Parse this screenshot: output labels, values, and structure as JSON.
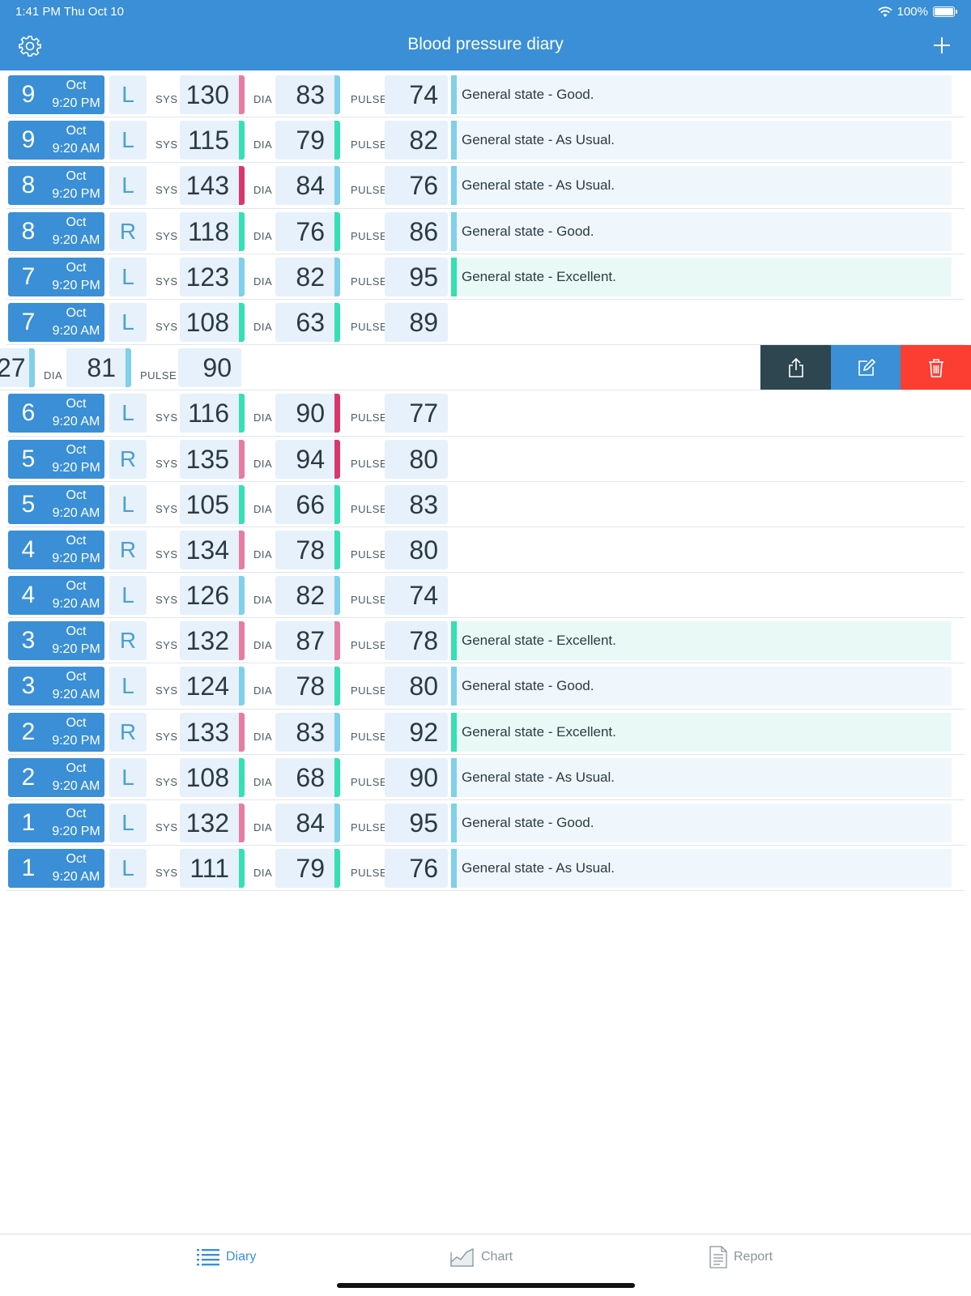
{
  "status_bar": {
    "time": "1:41 PM   Thu Oct 10",
    "battery": "100%"
  },
  "header": {
    "title": "Blood pressure diary"
  },
  "labels": {
    "sys": "SYS",
    "dia": "DIA",
    "pulse": "PULSE"
  },
  "colors": {
    "accent": "#3a8fd6",
    "bar_normal": "#7fd0ea",
    "bar_optimal": "#34e0b4",
    "bar_high_normal": "#e77ca3",
    "bar_high": "#d9366d",
    "note_excellent_bar": "#34e0b4",
    "note_default_bar": "#7fd0ea",
    "action_share": "#2d4650",
    "action_edit": "#3a8fd6",
    "action_delete": "#fb3d32"
  },
  "entries": [
    {
      "day": "9",
      "month": "Oct",
      "time": "9:20 PM",
      "arm": "L",
      "sys": "130",
      "dia": "83",
      "pulse": "74",
      "sys_color": "#e77ca3",
      "dia_color": "#7fd0ea",
      "note": "General state - Good.",
      "note_type": "good"
    },
    {
      "day": "9",
      "month": "Oct",
      "time": "9:20 AM",
      "arm": "L",
      "sys": "115",
      "dia": "79",
      "pulse": "82",
      "sys_color": "#34e0b4",
      "dia_color": "#34e0b4",
      "note": "General state - As Usual.",
      "note_type": "usual"
    },
    {
      "day": "8",
      "month": "Oct",
      "time": "9:20 PM",
      "arm": "L",
      "sys": "143",
      "dia": "84",
      "pulse": "76",
      "sys_color": "#d9366d",
      "dia_color": "#7fd0ea",
      "note": "General state - As Usual.",
      "note_type": "usual"
    },
    {
      "day": "8",
      "month": "Oct",
      "time": "9:20 AM",
      "arm": "R",
      "sys": "118",
      "dia": "76",
      "pulse": "86",
      "sys_color": "#34e0b4",
      "dia_color": "#34e0b4",
      "note": "General state - Good.",
      "note_type": "good"
    },
    {
      "day": "7",
      "month": "Oct",
      "time": "9:20 PM",
      "arm": "L",
      "sys": "123",
      "dia": "82",
      "pulse": "95",
      "sys_color": "#7fd0ea",
      "dia_color": "#7fd0ea",
      "note": "General state - Excellent.",
      "note_type": "excellent"
    },
    {
      "day": "7",
      "month": "Oct",
      "time": "9:20 AM",
      "arm": "L",
      "sys": "108",
      "dia": "63",
      "pulse": "89",
      "sys_color": "#34e0b4",
      "dia_color": "#34e0b4",
      "note": "",
      "note_type": ""
    },
    {
      "swiped": true,
      "sys_tail": "27",
      "dia": "81",
      "pulse": "90",
      "sys_color": "#7fd0ea",
      "dia_color": "#7fd0ea"
    },
    {
      "day": "6",
      "month": "Oct",
      "time": "9:20 AM",
      "arm": "L",
      "sys": "116",
      "dia": "90",
      "pulse": "77",
      "sys_color": "#34e0b4",
      "dia_color": "#d9366d",
      "note": "",
      "note_type": ""
    },
    {
      "day": "5",
      "month": "Oct",
      "time": "9:20 PM",
      "arm": "R",
      "sys": "135",
      "dia": "94",
      "pulse": "80",
      "sys_color": "#e77ca3",
      "dia_color": "#d9366d",
      "note": "",
      "note_type": ""
    },
    {
      "day": "5",
      "month": "Oct",
      "time": "9:20 AM",
      "arm": "L",
      "sys": "105",
      "dia": "66",
      "pulse": "83",
      "sys_color": "#34e0b4",
      "dia_color": "#34e0b4",
      "note": "",
      "note_type": ""
    },
    {
      "day": "4",
      "month": "Oct",
      "time": "9:20 PM",
      "arm": "R",
      "sys": "134",
      "dia": "78",
      "pulse": "80",
      "sys_color": "#e77ca3",
      "dia_color": "#34e0b4",
      "note": "",
      "note_type": ""
    },
    {
      "day": "4",
      "month": "Oct",
      "time": "9:20 AM",
      "arm": "L",
      "sys": "126",
      "dia": "82",
      "pulse": "74",
      "sys_color": "#7fd0ea",
      "dia_color": "#7fd0ea",
      "note": "",
      "note_type": ""
    },
    {
      "day": "3",
      "month": "Oct",
      "time": "9:20 PM",
      "arm": "R",
      "sys": "132",
      "dia": "87",
      "pulse": "78",
      "sys_color": "#e77ca3",
      "dia_color": "#e77ca3",
      "note": "General state - Excellent.",
      "note_type": "excellent"
    },
    {
      "day": "3",
      "month": "Oct",
      "time": "9:20 AM",
      "arm": "L",
      "sys": "124",
      "dia": "78",
      "pulse": "80",
      "sys_color": "#7fd0ea",
      "dia_color": "#34e0b4",
      "note": "General state - Good.",
      "note_type": "good"
    },
    {
      "day": "2",
      "month": "Oct",
      "time": "9:20 PM",
      "arm": "R",
      "sys": "133",
      "dia": "83",
      "pulse": "92",
      "sys_color": "#e77ca3",
      "dia_color": "#7fd0ea",
      "note": "General state - Excellent.",
      "note_type": "excellent"
    },
    {
      "day": "2",
      "month": "Oct",
      "time": "9:20 AM",
      "arm": "L",
      "sys": "108",
      "dia": "68",
      "pulse": "90",
      "sys_color": "#34e0b4",
      "dia_color": "#34e0b4",
      "note": "General state - As Usual.",
      "note_type": "usual"
    },
    {
      "day": "1",
      "month": "Oct",
      "time": "9:20 PM",
      "arm": "L",
      "sys": "132",
      "dia": "84",
      "pulse": "95",
      "sys_color": "#e77ca3",
      "dia_color": "#7fd0ea",
      "note": "General state - Good.",
      "note_type": "good"
    },
    {
      "day": "1",
      "month": "Oct",
      "time": "9:20 AM",
      "arm": "L",
      "sys": "111",
      "dia": "79",
      "pulse": "76",
      "sys_color": "#34e0b4",
      "dia_color": "#34e0b4",
      "note": "General state - As Usual.",
      "note_type": "usual"
    }
  ],
  "swipe_actions": {
    "share_icon": "share-icon",
    "edit_icon": "edit-icon",
    "delete_icon": "trash-icon"
  },
  "tabs": [
    {
      "label": "Diary",
      "icon": "list-icon",
      "active": true
    },
    {
      "label": "Chart",
      "icon": "chart-icon",
      "active": false
    },
    {
      "label": "Report",
      "icon": "document-icon",
      "active": false
    }
  ]
}
